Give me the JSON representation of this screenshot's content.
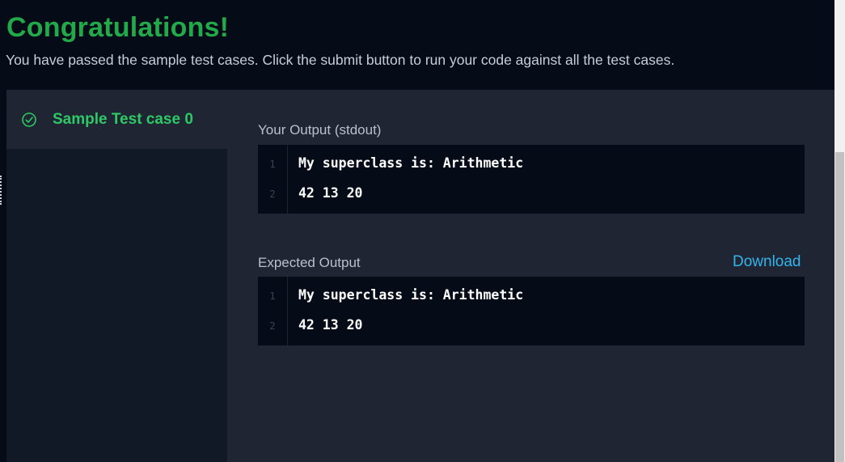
{
  "result": {
    "headline": "Congratulations!",
    "message": "You have passed the sample test cases. Click the submit button to run your code against all the test cases."
  },
  "testcases": [
    {
      "label": "Sample Test case 0",
      "status_icon": "check-circle-icon"
    }
  ],
  "your_output": {
    "label": "Your Output (stdout)",
    "lines": [
      {
        "no": "1",
        "text": "My superclass is: Arithmetic"
      },
      {
        "no": "2",
        "text": "42 13 20"
      }
    ]
  },
  "expected_output": {
    "label": "Expected Output",
    "download_label": "Download",
    "lines": [
      {
        "no": "1",
        "text": "My superclass is: Arithmetic"
      },
      {
        "no": "2",
        "text": "42 13 20"
      }
    ]
  },
  "colors": {
    "success": "#22a94a",
    "link": "#34b4eb",
    "background": "#050b17",
    "panel": "#1f2532"
  }
}
